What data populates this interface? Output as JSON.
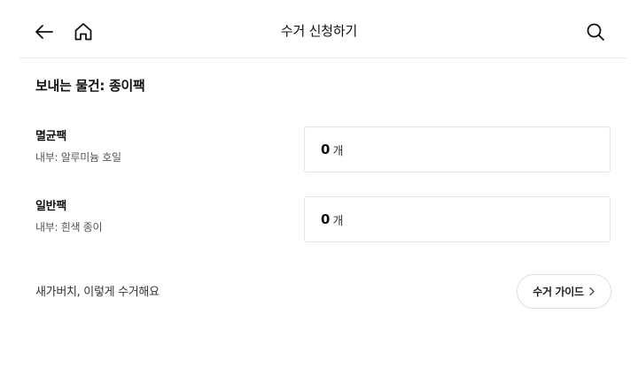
{
  "header": {
    "title": "수거 신청하기",
    "back_icon": "back-arrow-icon",
    "home_icon": "home-icon",
    "search_icon": "search-icon"
  },
  "section": {
    "title": "보내는 물건: 종이팩"
  },
  "items": [
    {
      "name": "멸균팩",
      "desc": "내부: 알루미늄 호일",
      "quantity": "0",
      "unit": "개"
    },
    {
      "name": "일반팩",
      "desc": "내부: 흰색 종이",
      "quantity": "0",
      "unit": "개"
    }
  ],
  "footer": {
    "text": "새가버치, 이렇게 수거해요",
    "guide_button": "수거 가이드",
    "guide_icon": "chevron-right-icon"
  },
  "colors": {
    "text": "#111111",
    "subtext": "#555555",
    "border": "#e3e3e3",
    "divider": "#e9e9e9"
  }
}
